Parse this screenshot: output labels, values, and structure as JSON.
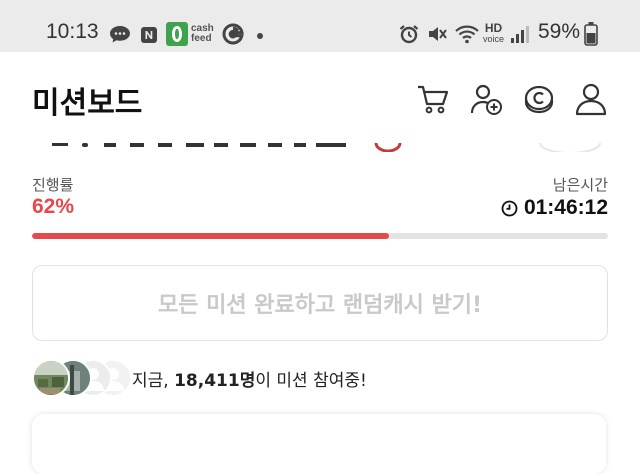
{
  "status_bar": {
    "time": "10:13",
    "battery": "59%",
    "left_icons": [
      "chat-icon",
      "n-badge-icon",
      "cashfeed-icon",
      "google-icon",
      "dot-icon"
    ],
    "right_icons": [
      "alarm-icon",
      "mute-icon",
      "wifi-icon",
      "hd-voice-icon",
      "signal-icon",
      "battery-icon"
    ],
    "cashfeed_label": "cash feed",
    "hd_label": "HD",
    "voice_label": "voice"
  },
  "header": {
    "title": "미션보드",
    "icons": [
      "cart-icon",
      "add-friend-icon",
      "coin-icon",
      "profile-icon"
    ]
  },
  "progress": {
    "label": "진행률",
    "value_text": "62%",
    "value": 0.62,
    "remaining_label": "남은시간",
    "timer": "01:46:12"
  },
  "cta": {
    "label": "모든 미션 완료하고 랜덤캐시 받기!"
  },
  "participants": {
    "prefix": "지금, ",
    "count": "18,411명",
    "suffix": "이 미션 참여중!"
  },
  "colors": {
    "accent": "#e5484d",
    "status_bg": "#ebebeb",
    "cta_text": "#c9c9c9"
  }
}
